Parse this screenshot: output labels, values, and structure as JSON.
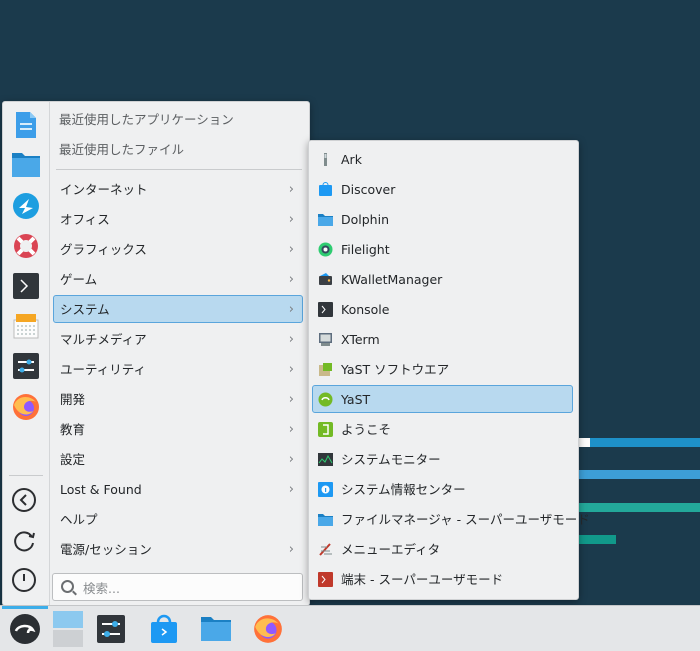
{
  "menu": {
    "recent_apps": "最近使用したアプリケーション",
    "recent_files": "最近使用したファイル",
    "categories": [
      {
        "label": "インターネット",
        "has_submenu": true
      },
      {
        "label": "オフィス",
        "has_submenu": true
      },
      {
        "label": "グラフィックス",
        "has_submenu": true
      },
      {
        "label": "ゲーム",
        "has_submenu": true
      },
      {
        "label": "システム",
        "has_submenu": true,
        "selected": true
      },
      {
        "label": "マルチメディア",
        "has_submenu": true
      },
      {
        "label": "ユーティリティ",
        "has_submenu": true
      },
      {
        "label": "開発",
        "has_submenu": true
      },
      {
        "label": "教育",
        "has_submenu": true
      },
      {
        "label": "設定",
        "has_submenu": true
      },
      {
        "label": "Lost & Found",
        "has_submenu": true
      },
      {
        "label": "ヘルプ",
        "has_submenu": false
      },
      {
        "label": "電源/セッション",
        "has_submenu": true
      }
    ],
    "search_placeholder": "検索...",
    "favorites": [
      "document-icon",
      "folder-icon",
      "kde-connect-icon",
      "help-lifebuoy-icon",
      "terminal-icon",
      "system-info-icon",
      "settings-sliders-icon",
      "firefox-icon"
    ],
    "session_buttons": [
      "logout-icon",
      "restart-icon",
      "shutdown-icon"
    ]
  },
  "submenu": {
    "items": [
      {
        "label": "Ark",
        "icon": "archive-icon"
      },
      {
        "label": "Discover",
        "icon": "discover-icon"
      },
      {
        "label": "Dolphin",
        "icon": "folder-icon"
      },
      {
        "label": "Filelight",
        "icon": "filelight-icon"
      },
      {
        "label": "KWalletManager",
        "icon": "wallet-icon"
      },
      {
        "label": "Konsole",
        "icon": "terminal-icon"
      },
      {
        "label": "XTerm",
        "icon": "xterm-icon"
      },
      {
        "label": "YaST ソフトウエア",
        "icon": "yast-software-icon"
      },
      {
        "label": "YaST",
        "icon": "yast-icon",
        "selected": true
      },
      {
        "label": "ようこそ",
        "icon": "welcome-icon"
      },
      {
        "label": "システムモニター",
        "icon": "system-monitor-icon"
      },
      {
        "label": "システム情報センター",
        "icon": "info-center-icon"
      },
      {
        "label": "ファイルマネージャ - スーパーユーザモード",
        "icon": "folder-root-icon"
      },
      {
        "label": "メニューエディタ",
        "icon": "menu-editor-icon"
      },
      {
        "label": "端末 - スーパーユーザモード",
        "icon": "terminal-root-icon"
      }
    ]
  },
  "taskbar": {
    "items": [
      "opensuse-launcher-icon",
      "pager-icon",
      "system-settings-icon",
      "discover-icon",
      "dolphin-icon",
      "firefox-icon"
    ]
  },
  "colors": {
    "desktop": "#1b3a4c",
    "highlight": "#b8d9ef",
    "highlight_border": "#5aa5dc",
    "accent": "#3daee9"
  }
}
